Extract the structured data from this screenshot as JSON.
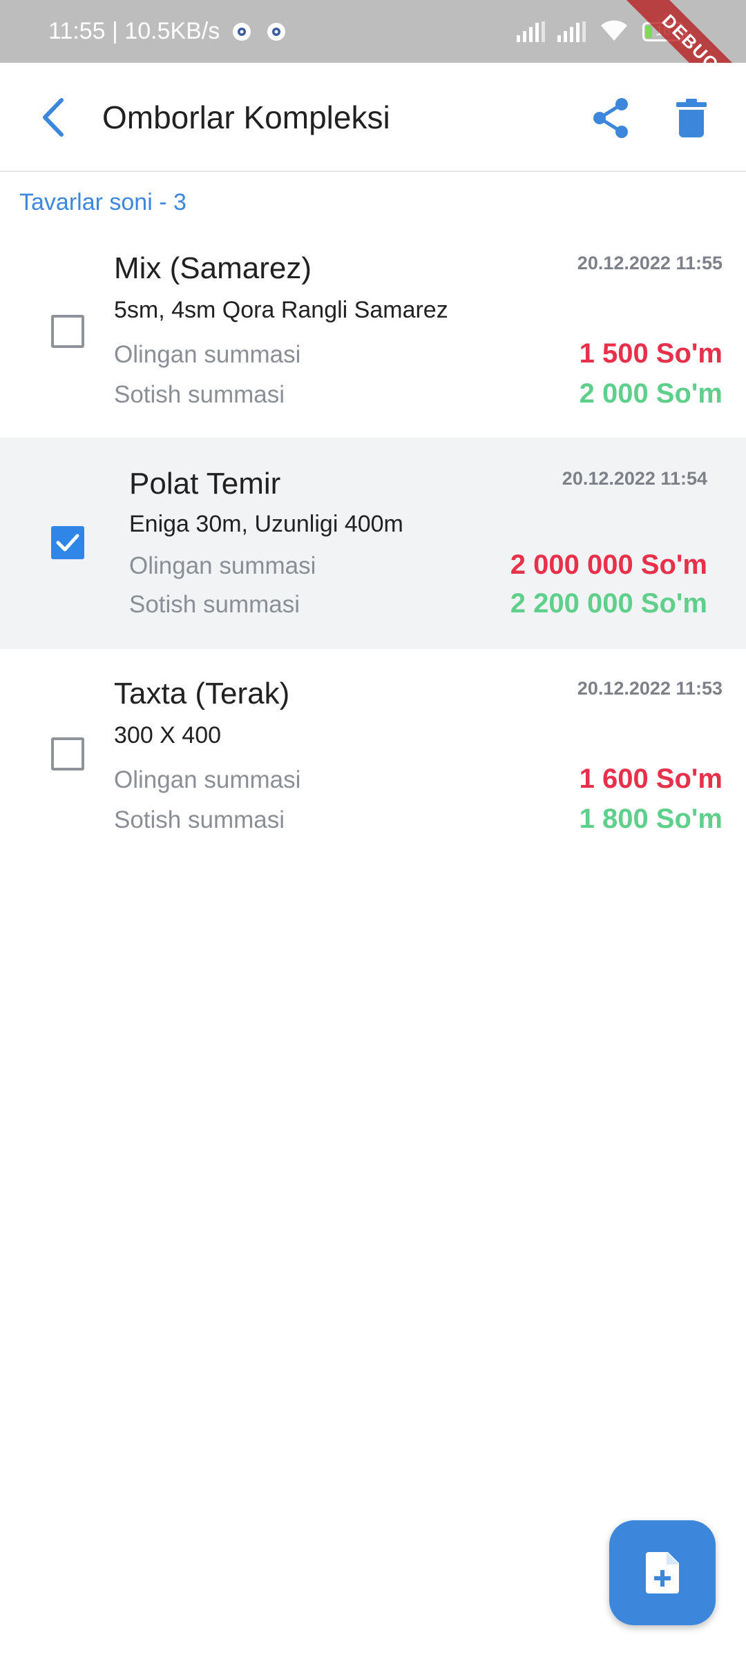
{
  "status_bar": {
    "time_speed": "11:55 | 10.5KB/s",
    "battery_level": "16",
    "debug_label": "DEBUG"
  },
  "app_bar": {
    "title": "Omborlar Kompleksi"
  },
  "list": {
    "count_label": "Tavarlar soni - 3",
    "items": [
      {
        "name": "Mix (Samarez)",
        "description": "5sm, 4sm Qora Rangli Samarez",
        "date": "20.12.2022 11:55",
        "buy_label": "Olingan summasi",
        "buy_price": "1 500 So'm",
        "sell_label": "Sotish summasi",
        "sell_price": "2 000 So'm",
        "checked": false
      },
      {
        "name": "Polat Temir",
        "description": "Eniga 30m, Uzunligi 400m",
        "date": "20.12.2022 11:54",
        "buy_label": "Olingan summasi",
        "buy_price": "2 000 000 So'm",
        "sell_label": "Sotish summasi",
        "sell_price": "2 200 000 So'm",
        "checked": true
      },
      {
        "name": "Taxta (Terak)",
        "description": "300 X 400",
        "date": "20.12.2022 11:53",
        "buy_label": "Olingan summasi",
        "buy_price": "1 600 So'm",
        "sell_label": "Sotish summasi",
        "sell_price": "1 800 So'm",
        "checked": false
      }
    ]
  },
  "colors": {
    "accent": "#3c86dc",
    "buy_price": "#e7304a",
    "sell_price": "#5fcf8b",
    "selected_row": "#f2f3f5"
  },
  "icons": {
    "back": "arrow-back-icon",
    "share": "share-icon",
    "delete": "trash-icon",
    "fab": "add-document-icon"
  }
}
